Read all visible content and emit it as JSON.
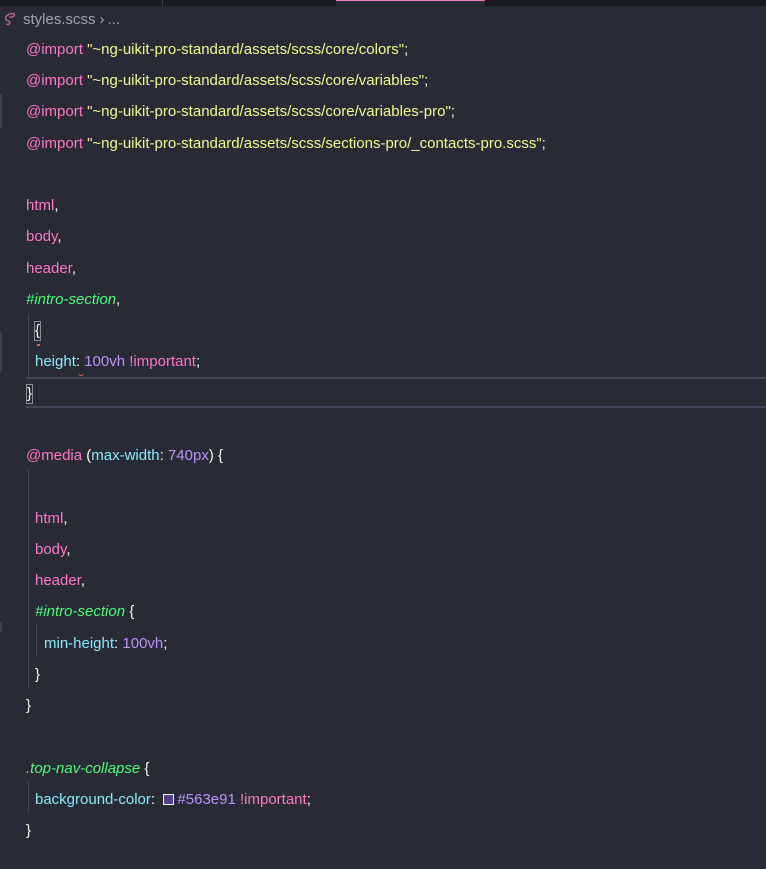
{
  "breadcrumb": {
    "file": "styles.scss",
    "ellipsis": "..."
  },
  "colors": {
    "background": "#282a36",
    "keyword": "#ff79c6",
    "string": "#f1fa8c",
    "selector_id": "#50fa7b",
    "property": "#8be9fd",
    "number": "#bd93f9",
    "swatch": "#563e91"
  },
  "icons": {
    "file": "sass-icon",
    "separator": "chevron-right-icon"
  },
  "code": {
    "import1_kw": "@import",
    "import1_str": "\"~ng-uikit-pro-standard/assets/scss/core/colors\"",
    "import2_kw": "@import",
    "import2_str": "\"~ng-uikit-pro-standard/assets/scss/core/variables\"",
    "import3_kw": "@import",
    "import3_str": "\"~ng-uikit-pro-standard/assets/scss/core/variables-pro\"",
    "import4_kw": "@import",
    "import4_str": "\"~ng-uikit-pro-standard/assets/scss/sections-pro/_contacts-pro.scss\"",
    "semicolon": ";",
    "comma": ",",
    "sel_html": "html",
    "sel_body": "body",
    "sel_header": "header",
    "sel_intro": "#intro-section",
    "open_brace": "{",
    "close_brace": "}",
    "prop_height": "height",
    "colon": ":",
    "val_100vh": "100vh",
    "important": "!important",
    "media_kw": "@media",
    "media_open": "(",
    "media_prop": "max-width",
    "media_val": "740px",
    "media_close": ")",
    "prop_min_height": "min-height",
    "sel_top_nav": ".top-nav-collapse",
    "prop_bg": "background-color",
    "val_hex": "#563e91"
  }
}
